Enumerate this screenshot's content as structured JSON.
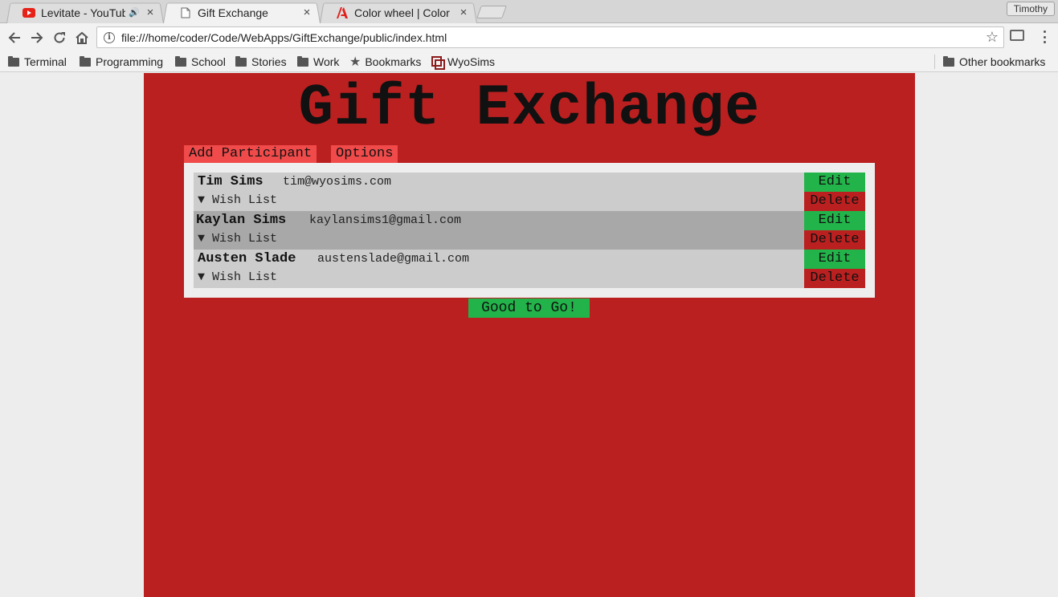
{
  "browser": {
    "tabs": [
      {
        "title": "Levitate - YouTube",
        "icon": "youtube-icon",
        "audio": true
      },
      {
        "title": "Gift Exchange",
        "icon": "page-icon",
        "active": true
      },
      {
        "title": "Color wheel | Color sche",
        "icon": "adobe-icon"
      }
    ],
    "profile_name": "Timothy",
    "url": "file:///home/coder/Code/WebApps/GiftExchange/public/index.html",
    "bookmarks": [
      {
        "label": "Terminal",
        "icon": "folder-icon"
      },
      {
        "label": "Programming",
        "icon": "folder-icon"
      },
      {
        "label": "School",
        "icon": "folder-icon"
      },
      {
        "label": "Stories",
        "icon": "folder-icon"
      },
      {
        "label": "Work",
        "icon": "folder-icon"
      },
      {
        "label": "Bookmarks",
        "icon": "star-icon"
      },
      {
        "label": "WyoSims",
        "icon": "wyosims-icon"
      }
    ],
    "other_bookmarks": "Other bookmarks"
  },
  "page": {
    "title": "Gift Exchange",
    "nav": {
      "add_participant": "Add Participant",
      "options": "Options"
    },
    "participants": [
      {
        "name": "Tim Sims",
        "email": "tim@wyosims.com",
        "wish_list": "▼ Wish List",
        "edit": "Edit",
        "delete": "Delete"
      },
      {
        "name": "Kaylan Sims",
        "email": "kaylansims1@gmail.com",
        "wish_list": "▼ Wish List",
        "edit": "Edit",
        "delete": "Delete"
      },
      {
        "name": "Austen Slade",
        "email": "austenslade@gmail.com",
        "wish_list": "▼ Wish List",
        "edit": "Edit",
        "delete": "Delete"
      }
    ],
    "good_to_go": "Good to Go!"
  },
  "colors": {
    "page_background": "#bb2020",
    "accent_green": "#22b44a",
    "tab_red": "#f04a4a",
    "row_light": "#cccccc",
    "row_dark": "#a8a8a8"
  }
}
